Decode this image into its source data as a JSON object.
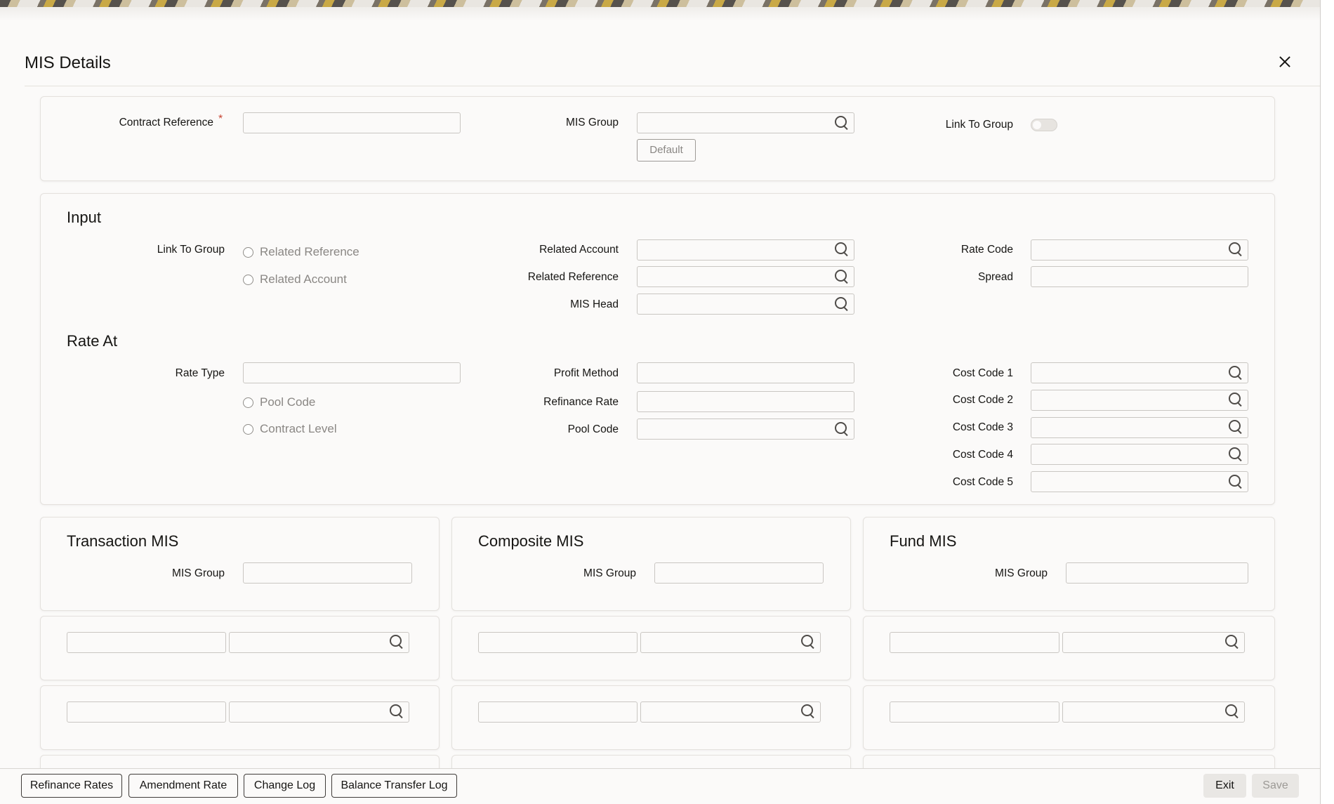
{
  "dialog": {
    "title": "MIS Details"
  },
  "header": {
    "contract_reference_label": "Contract Reference",
    "required_marker": "*",
    "mis_group_label": "MIS Group",
    "default_button": "Default",
    "link_to_group_label": "Link To Group"
  },
  "input": {
    "title": "Input",
    "link_to_group_label": "Link To Group",
    "radio_related_reference": "Related Reference",
    "radio_related_account": "Related Account",
    "related_account_label": "Related Account",
    "related_reference_label": "Related Reference",
    "mis_head_label": "MIS Head",
    "rate_code_label": "Rate Code",
    "spread_label": "Spread"
  },
  "rate_at": {
    "title": "Rate At",
    "rate_type_label": "Rate Type",
    "radio_pool_code": "Pool Code",
    "radio_contract_level": "Contract Level",
    "profit_method_label": "Profit Method",
    "refinance_rate_label": "Refinance Rate",
    "pool_code_label": "Pool Code",
    "cost_code_1_label": "Cost Code 1",
    "cost_code_2_label": "Cost Code 2",
    "cost_code_3_label": "Cost Code 3",
    "cost_code_4_label": "Cost Code 4",
    "cost_code_5_label": "Cost Code 5"
  },
  "transaction_mis": {
    "title": "Transaction MIS",
    "mis_group_label": "MIS Group"
  },
  "composite_mis": {
    "title": "Composite MIS",
    "mis_group_label": "MIS Group"
  },
  "fund_mis": {
    "title": "Fund MIS",
    "mis_group_label": "MIS Group"
  },
  "footer": {
    "refinance_rates": "Refinance Rates",
    "amendment_rate": "Amendment Rate",
    "change_log": "Change Log",
    "balance_transfer_log": "Balance Transfer Log",
    "exit": "Exit",
    "save": "Save"
  },
  "icons": {
    "search": "search-icon",
    "close": "close-icon"
  }
}
